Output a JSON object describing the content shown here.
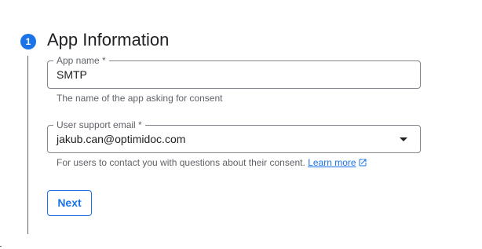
{
  "step": {
    "number": "1",
    "title": "App Information"
  },
  "app_name": {
    "label": "App name *",
    "value": "SMTP",
    "helper": "The name of the app asking for consent"
  },
  "support_email": {
    "label": "User support email *",
    "value": "jakub.can@optimidoc.com",
    "helper": "For users to contact you with questions about their consent.",
    "link_text": "Learn more"
  },
  "next_button": {
    "label": "Next"
  },
  "icons": {
    "dropdown": "chevron-down-icon",
    "external_link": "open-in-new-icon"
  },
  "colors": {
    "accent": "#1a73e8",
    "border": "#80868b",
    "text": "#202124",
    "secondary_text": "#5f6368"
  }
}
